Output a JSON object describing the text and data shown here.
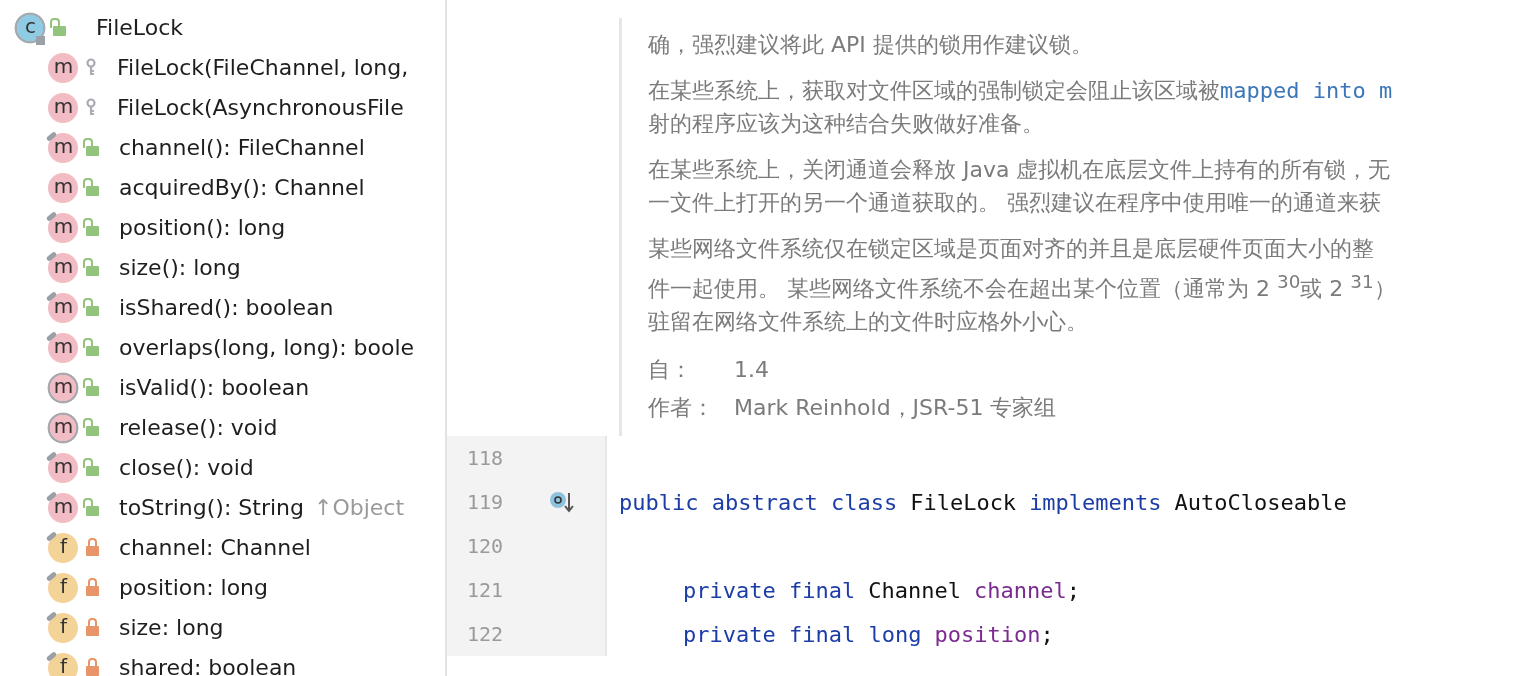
{
  "structure": {
    "root": {
      "badge": "c",
      "kind": "class",
      "abstract": true,
      "public": true,
      "label": "FileLock",
      "children": [
        {
          "badge": "m",
          "kind": "method",
          "abstract": false,
          "final": false,
          "public": false,
          "private": false,
          "label": "FileLock(FileChannel, long,"
        },
        {
          "badge": "m",
          "kind": "method",
          "abstract": false,
          "final": false,
          "public": false,
          "private": false,
          "label": "FileLock(AsynchronousFile"
        },
        {
          "badge": "m",
          "kind": "method",
          "abstract": false,
          "final": true,
          "public": true,
          "private": false,
          "label": "channel(): FileChannel"
        },
        {
          "badge": "m",
          "kind": "method",
          "abstract": false,
          "final": false,
          "public": true,
          "private": false,
          "label": "acquiredBy(): Channel"
        },
        {
          "badge": "m",
          "kind": "method",
          "abstract": false,
          "final": true,
          "public": true,
          "private": false,
          "label": "position(): long"
        },
        {
          "badge": "m",
          "kind": "method",
          "abstract": false,
          "final": true,
          "public": true,
          "private": false,
          "label": "size(): long"
        },
        {
          "badge": "m",
          "kind": "method",
          "abstract": false,
          "final": true,
          "public": true,
          "private": false,
          "label": "isShared(): boolean"
        },
        {
          "badge": "m",
          "kind": "method",
          "abstract": false,
          "final": true,
          "public": true,
          "private": false,
          "label": "overlaps(long, long): boole"
        },
        {
          "badge": "m",
          "kind": "method",
          "abstract": true,
          "final": false,
          "public": true,
          "private": false,
          "label": "isValid(): boolean"
        },
        {
          "badge": "m",
          "kind": "method",
          "abstract": true,
          "final": false,
          "public": true,
          "private": false,
          "label": "release(): void"
        },
        {
          "badge": "m",
          "kind": "method",
          "abstract": false,
          "final": true,
          "public": true,
          "private": false,
          "label": "close(): void"
        },
        {
          "badge": "m",
          "kind": "method",
          "abstract": false,
          "final": true,
          "public": true,
          "private": false,
          "label": "toString(): String",
          "inherited": "↑Object"
        },
        {
          "badge": "f",
          "kind": "field",
          "abstract": false,
          "final": true,
          "public": false,
          "private": true,
          "label": "channel: Channel"
        },
        {
          "badge": "f",
          "kind": "field",
          "abstract": false,
          "final": true,
          "public": false,
          "private": true,
          "label": "position: long"
        },
        {
          "badge": "f",
          "kind": "field",
          "abstract": false,
          "final": true,
          "public": false,
          "private": true,
          "label": "size: long"
        },
        {
          "badge": "f",
          "kind": "field",
          "abstract": false,
          "final": true,
          "public": false,
          "private": true,
          "label": "shared: boolean"
        }
      ]
    }
  },
  "documentation": {
    "paragraphs": [
      [
        {
          "text": "确，强烈建议将此 API 提供的锁用作建议锁。"
        }
      ],
      [
        {
          "text": "在某些系统上，获取对文件区域的强制锁定会阻止该区域被",
          "link": "mapped into m"
        },
        {
          "text": "射的程序应该为这种结合失败做好准备。"
        }
      ],
      [
        {
          "text": "在某些系统上，关闭通道会释放 Java 虚拟机在底层文件上持有的所有锁，无"
        },
        {
          "text": "一文件上打开的另一个通道获取的。 强烈建议在程序中使用唯一的通道来获"
        }
      ],
      [
        {
          "text": "某些网络文件系统仅在锁定区域是页面对齐的并且是底层硬件页面大小的整"
        },
        {
          "text": "件一起使用。 某些网络文件系统不会在超出某个位置（通常为 2 $^{30}$或 2 $^{31}$）"
        },
        {
          "text": "驻留在网络文件系统上的文件时应格外小心。"
        }
      ]
    ],
    "tags": [
      {
        "label": "自：",
        "value": "1.4"
      },
      {
        "label": "作者：",
        "value": "Mark Reinhold，JSR-51 专家组"
      }
    ]
  },
  "code": {
    "lines": [
      {
        "number": "118"
      },
      {
        "number": "119",
        "implemented_marker": true,
        "tokens": [
          {
            "kind": "keyword",
            "text": "public abstract class"
          },
          {
            "kind": "plain",
            "text": "FileLock"
          },
          {
            "kind": "keyword",
            "text": "implements"
          },
          {
            "kind": "plain",
            "text": "AutoCloseable"
          }
        ]
      },
      {
        "number": "120"
      },
      {
        "number": "121",
        "indent": true,
        "tokens": [
          {
            "kind": "keyword",
            "text": "private final"
          },
          {
            "kind": "plain",
            "text": "Channel"
          },
          {
            "kind": "field",
            "text": "channel"
          },
          {
            "kind": "punct",
            "text": ";"
          }
        ]
      },
      {
        "number": "122",
        "indent": true,
        "tokens": [
          {
            "kind": "keyword",
            "text": "private final long"
          },
          {
            "kind": "field",
            "text": "position"
          },
          {
            "kind": "punct",
            "text": ";"
          }
        ]
      }
    ]
  }
}
